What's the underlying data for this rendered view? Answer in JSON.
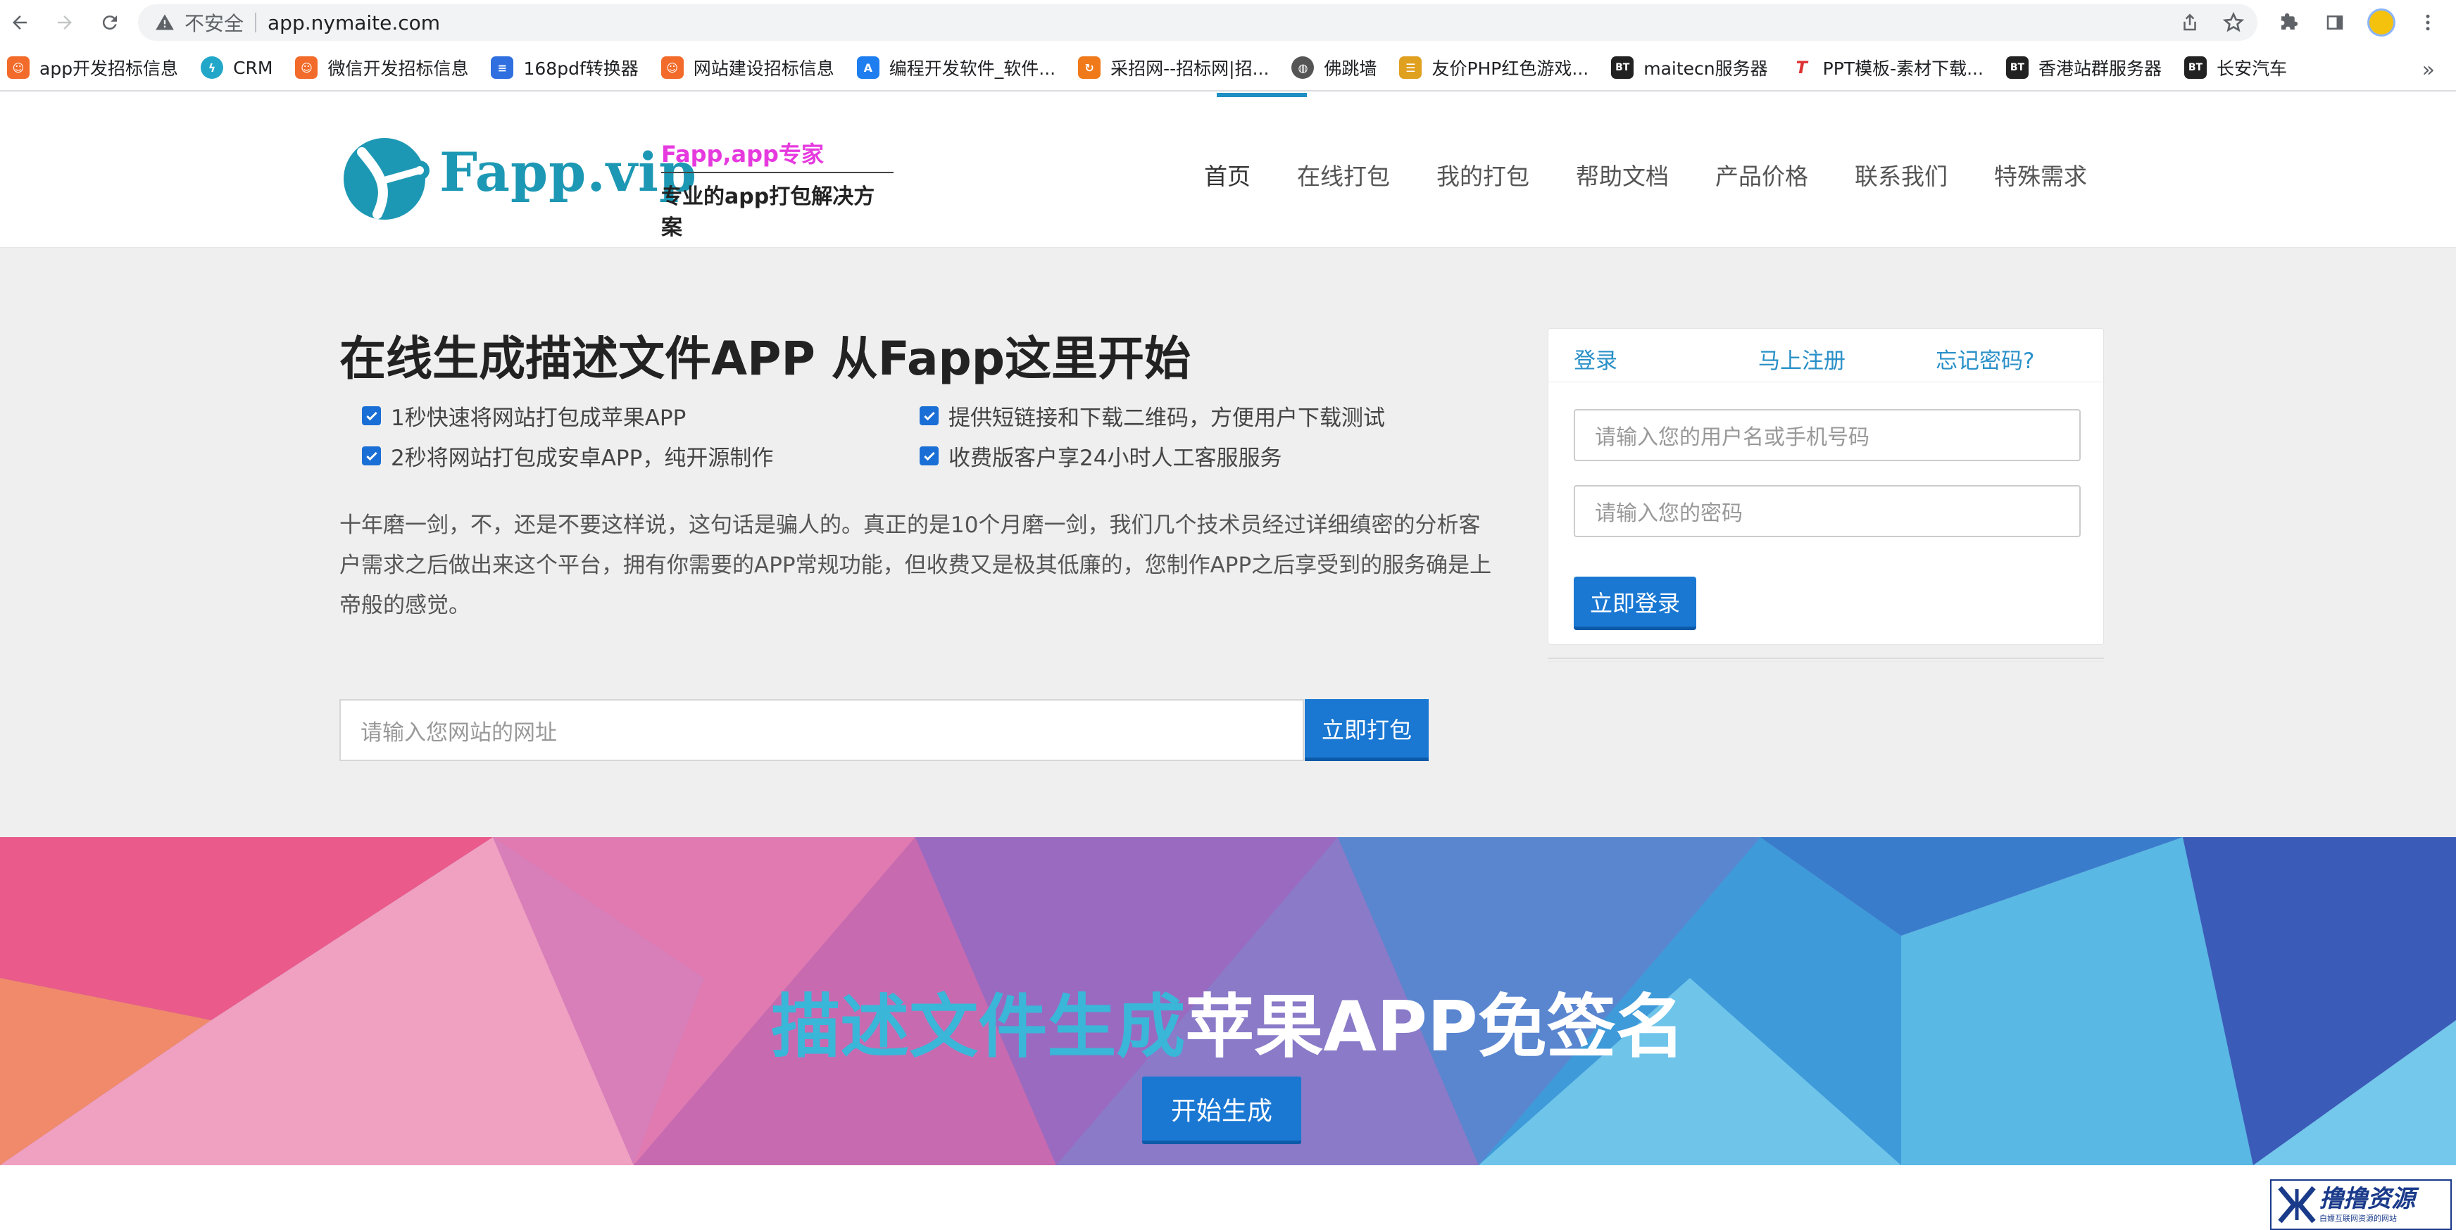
{
  "browser": {
    "security_label": "不安全",
    "url": "app.nymaite.com",
    "bookmarks": [
      {
        "label": "app开发招标信息",
        "icon": "orange-face-icon",
        "color": "#f26b2a"
      },
      {
        "label": "CRM",
        "icon": "bolt-icon",
        "color": "#22a7c9"
      },
      {
        "label": "微信开发招标信息",
        "icon": "orange-face-icon",
        "color": "#f26b2a"
      },
      {
        "label": "168pdf转换器",
        "icon": "pdf-icon",
        "color": "#2f6fe0"
      },
      {
        "label": "网站建设招标信息",
        "icon": "orange-face-icon",
        "color": "#f26b2a"
      },
      {
        "label": "编程开发软件_软件...",
        "icon": "app-store-icon",
        "color": "#1e7ef0"
      },
      {
        "label": "采招网--招标网|招...",
        "icon": "refresh-orange-icon",
        "color": "#f07a1a"
      },
      {
        "label": "佛跳墙",
        "icon": "globe-icon",
        "color": "#555555"
      },
      {
        "label": "友价PHP红色游戏...",
        "icon": "stack-icon",
        "color": "#e0a020"
      },
      {
        "label": "maitecn服务器",
        "icon": "bt-icon",
        "color": "#222222"
      },
      {
        "label": "PPT模板-素材下载...",
        "icon": "t-icon",
        "color": "#d33"
      },
      {
        "label": "香港站群服务器",
        "icon": "bt-icon",
        "color": "#222222"
      },
      {
        "label": "长安汽车",
        "icon": "bt-icon",
        "color": "#222222"
      }
    ],
    "more_label": "»"
  },
  "site": {
    "logo": {
      "name": "Fapp.vip",
      "tagline": "Fapp,app专家",
      "subtitle": "专业的app打包解决方案"
    },
    "nav": [
      "首页",
      "在线打包",
      "我的打包",
      "帮助文档",
      "产品价格",
      "联系我们",
      "特殊需求"
    ],
    "hero": {
      "title": "在线生成描述文件APP 从Fapp这里开始",
      "features": [
        "1秒快速将网站打包成苹果APP",
        "提供短链接和下载二维码，方便用户下载测试",
        "2秒将网站打包成安卓APP，纯开源制作",
        "收费版客户享24小时人工客服服务"
      ],
      "description": "十年磨一剑，不，还是不要这样说，这句话是骗人的。真正的是10个月磨一剑，我们几个技术员经过详细缜密的分析客户需求之后做出来这个平台，拥有你需要的APP常规功能，但收费又是极其低廉的，您制作APP之后享受到的服务确是上帝般的感觉。",
      "url_placeholder": "请输入您网站的网址",
      "pack_button": "立即打包"
    },
    "login": {
      "tab_login": "登录",
      "tab_register": "马上注册",
      "tab_forgot": "忘记密码?",
      "username_placeholder": "请输入您的用户名或手机号码",
      "password_placeholder": "请输入您的密码",
      "submit": "立即登录"
    },
    "banner": {
      "title_highlight": "描述文件生成",
      "title_rest": "苹果APP免签名",
      "button": "开始生成"
    },
    "watermark": {
      "name": "撸撸资源",
      "sub": "白嫖互联网资源的网站"
    }
  },
  "colors": {
    "brand_blue": "#1a78d3",
    "link_blue": "#2a90c8",
    "logo_teal": "#1d98b4",
    "tagline_pink": "#e63adf",
    "hero_bg": "#efefef",
    "banner_highlight": "#3ab6d8"
  }
}
